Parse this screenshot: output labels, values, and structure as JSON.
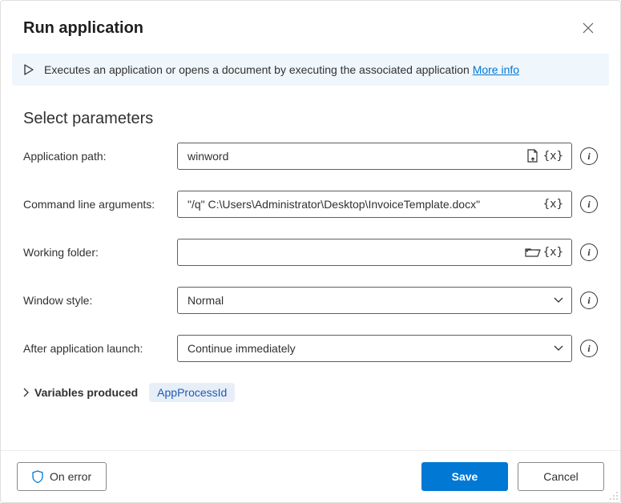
{
  "dialog": {
    "title": "Run application",
    "banner_text": "Executes an application or opens a document by executing the associated application ",
    "banner_link": "More info",
    "section": "Select parameters"
  },
  "labels": {
    "app_path": "Application path:",
    "cli_args": "Command line arguments:",
    "working_folder": "Working folder:",
    "window_style": "Window style:",
    "after_launch": "After application launch:",
    "vars_produced": "Variables produced"
  },
  "values": {
    "app_path": "winword",
    "cli_args": "\"/q\" C:\\Users\\Administrator\\Desktop\\InvoiceTemplate.docx\"",
    "working_folder": "",
    "window_style": "Normal",
    "after_launch": "Continue immediately"
  },
  "variables": {
    "chip": "AppProcessId"
  },
  "buttons": {
    "on_error": "On error",
    "save": "Save",
    "cancel": "Cancel"
  },
  "glyphs": {
    "var": "{x}"
  }
}
